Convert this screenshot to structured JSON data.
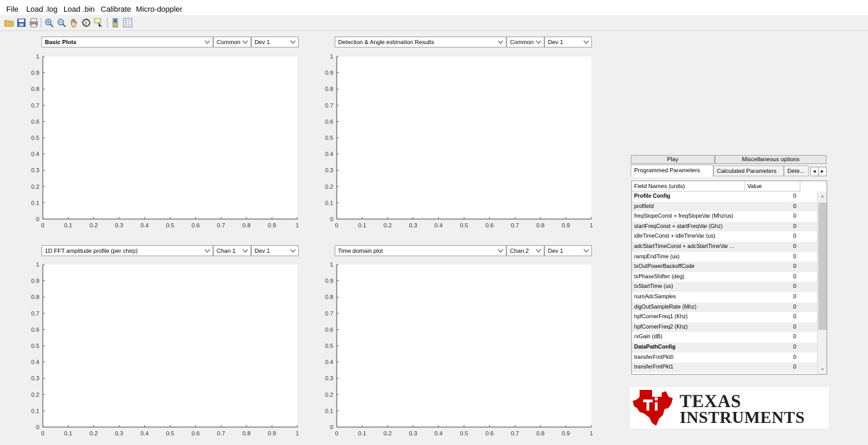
{
  "menu": {
    "items": [
      "File",
      "Load .log",
      "Load .bin",
      "Calibrate",
      "Micro-doppler"
    ]
  },
  "toolbar": {
    "icons": [
      "open-folder-icon",
      "save-icon",
      "print-icon",
      "zoom-in-icon",
      "zoom-out-icon",
      "pan-hand-icon",
      "rotate-3d-icon",
      "data-cursor-icon",
      "colorbar-icon",
      "legend-icon"
    ]
  },
  "plots": [
    {
      "plot_select": "Basic Plots",
      "select2": "Common",
      "select3": "Dev 1"
    },
    {
      "plot_select": "Detection & Angle estimation Results",
      "select2": "Common",
      "select3": "Dev 1"
    },
    {
      "plot_select": "1D FFT amplitude profile (per chirp)",
      "select2": "Chan 1",
      "select3": "Dev 1"
    },
    {
      "plot_select": "Time domain plot",
      "select2": "Chan 2",
      "select3": "Dev 1"
    }
  ],
  "axes": {
    "xlim": [
      0,
      1
    ],
    "ylim": [
      0,
      1
    ],
    "x_ticks": [
      "0",
      "0.1",
      "0.2",
      "0.3",
      "0.4",
      "0.5",
      "0.6",
      "0.7",
      "0.8",
      "0.9",
      "1"
    ],
    "y_ticks": [
      "0",
      "0.1",
      "0.2",
      "0.3",
      "0.4",
      "0.5",
      "0.6",
      "0.7",
      "0.8",
      "0.9",
      "1"
    ]
  },
  "right_panel": {
    "top_tabs": [
      "Play",
      "Miscellaneous options"
    ],
    "sub_tabs": [
      "Programmed Parameters",
      "Calculated Parameters",
      "Dete..."
    ],
    "nav_prev": "◂",
    "nav_next": "▸",
    "table": {
      "headers": [
        "Field Names   (units)",
        "Value"
      ],
      "rows": [
        {
          "name": "Profile Config",
          "value": "0",
          "section": true
        },
        {
          "name": "profileId",
          "value": "0",
          "section": false
        },
        {
          "name": "freqSlopeConst + freqSlopeVar (Mhz/us)",
          "value": "0",
          "section": false
        },
        {
          "name": "startFreqConst + startFreqVar (Ghz)",
          "value": "0",
          "section": false
        },
        {
          "name": "idleTimeConst + idleTimeVar (us)",
          "value": "0",
          "section": false
        },
        {
          "name": "adcStartTimeConst + adcStartTimeVar ...",
          "value": "0",
          "section": false
        },
        {
          "name": "rampEndTime (us)",
          "value": "0",
          "section": false
        },
        {
          "name": "txOutPowerBackoffCode",
          "value": "0",
          "section": false
        },
        {
          "name": "txPhaseShifter (deg)",
          "value": "0",
          "section": false
        },
        {
          "name": "txStartTime (us)",
          "value": "0",
          "section": false
        },
        {
          "name": "numAdcSamples",
          "value": "0",
          "section": false
        },
        {
          "name": "digOutSampleRate (Mhz)",
          "value": "0",
          "section": false
        },
        {
          "name": "hpfCornerFreq1 (Khz)",
          "value": "0",
          "section": false
        },
        {
          "name": "hpfCornerFreq2 (Khz)",
          "value": "0",
          "section": false
        },
        {
          "name": "rxGain (dB)",
          "value": "0",
          "section": false
        },
        {
          "name": "DataPathConfig",
          "value": "0",
          "section": true
        },
        {
          "name": "transferFmtPkt0",
          "value": "0",
          "section": false
        },
        {
          "name": "transferFmtPkt1",
          "value": "0",
          "section": false
        }
      ]
    }
  },
  "logo": {
    "line1": "Texas",
    "line2": "Instruments",
    "brand_red": "#cc0000"
  },
  "colors": {
    "plot_bg": "#ffffff",
    "window_bg": "#f0f0f0",
    "axis": "#4d4d4d"
  }
}
